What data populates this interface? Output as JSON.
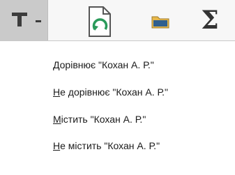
{
  "toolbar": {
    "filter_icon": "funnel-icon",
    "dropdown_icon": "chevron-down-icon",
    "doc_icon": "document-refresh-icon",
    "folder_icon": "folder-icon",
    "sigma_symbol": "Σ",
    "colors": {
      "filter_bg": "#cacaca",
      "toolbar_bg": "#f7f7f7",
      "refresh_arrow": "#2a9a5a",
      "folder": "#e8b84a"
    }
  },
  "menu": {
    "items": [
      {
        "key": "Д",
        "rest": "орівнює \"Кохан А. Р.\""
      },
      {
        "key": "Н",
        "rest": "е дорівнює \"Кохан А. Р.\""
      },
      {
        "key": "М",
        "rest": "істить \"Кохан А. Р.\""
      },
      {
        "key": "Н",
        "rest": "е містить \"Кохан А. Р.\""
      }
    ]
  }
}
